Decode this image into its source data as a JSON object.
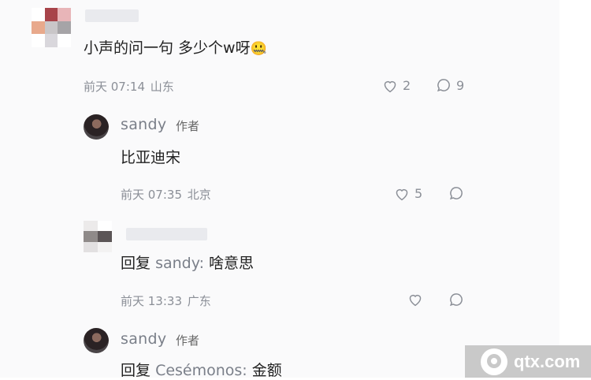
{
  "comments": [
    {
      "content": "小声的问一句 多少个w呀",
      "emoji": "🤐",
      "time": "前天 07:14",
      "location": "山东",
      "likes": "2",
      "replies": "9"
    },
    {
      "name": "sandy",
      "tag": "作者",
      "content": "比亚迪宋",
      "time": "前天 07:35",
      "location": "北京",
      "likes": "5"
    },
    {
      "reply_prefix": "回复",
      "reply_target": "sandy:",
      "content": "啥意思",
      "time": "前天 13:33",
      "location": "广东"
    },
    {
      "name": "sandy",
      "tag": "作者",
      "reply_prefix": "回复",
      "reply_target": "Cesémonos:",
      "content": "金额"
    }
  ],
  "watermark": {
    "text": "qtx.com"
  },
  "icons": [
    "heart-icon",
    "comment-icon",
    "watermark-logo-icon"
  ],
  "colors": {
    "meta": "#8b8f97",
    "name": "#7a7f89",
    "watermark_bg": "#c9c9c9"
  }
}
